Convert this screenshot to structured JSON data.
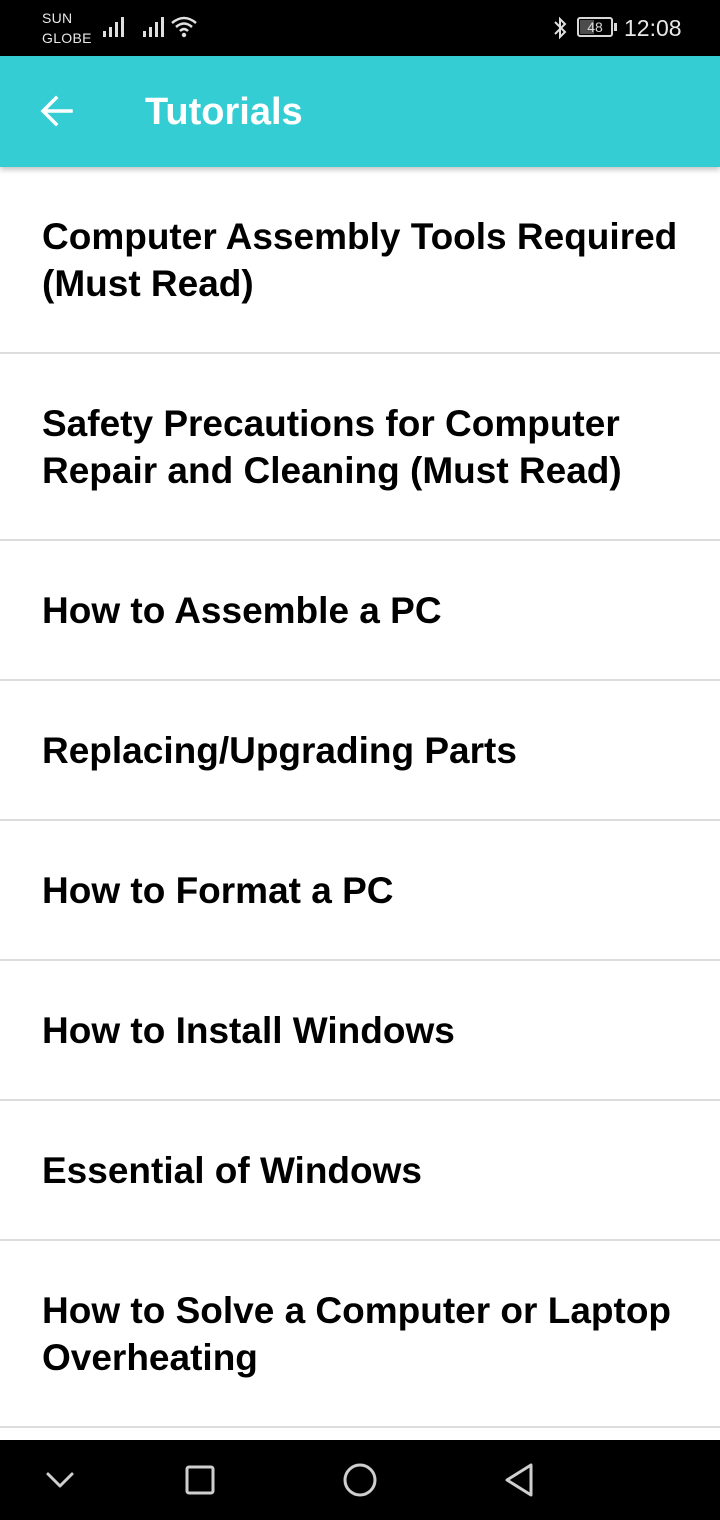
{
  "status_bar": {
    "carrier_line1": "SUN",
    "carrier_line2": "GLOBE",
    "battery_level": "48",
    "battery_fraction": 0.48,
    "time": "12:08",
    "icons": [
      "signal-icon",
      "signal-icon",
      "wifi-icon",
      "bluetooth-icon",
      "battery-icon"
    ]
  },
  "app_bar": {
    "back_icon": "arrow-left-icon",
    "title": "Tutorials",
    "background_color": "#33cdd3"
  },
  "tutorials": [
    {
      "label": "Computer Assembly Tools Required (Must Read)"
    },
    {
      "label": "Safety Precautions for Computer Repair and Cleaning (Must Read)"
    },
    {
      "label": "How to Assemble a PC"
    },
    {
      "label": "Replacing/Upgrading Parts"
    },
    {
      "label": "How to Format a PC"
    },
    {
      "label": "How to Install Windows"
    },
    {
      "label": "Essential of Windows"
    },
    {
      "label": "How to Solve a Computer or Laptop Overheating"
    }
  ],
  "nav_bar": {
    "icons": [
      "chevron-down-icon",
      "square-icon",
      "circle-icon",
      "triangle-back-icon"
    ]
  }
}
